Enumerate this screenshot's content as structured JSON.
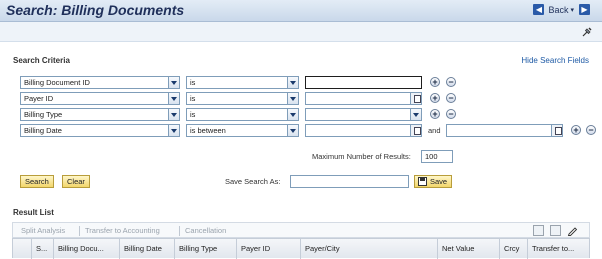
{
  "header": {
    "title": "Search: Billing Documents",
    "back_label": "Back"
  },
  "search_criteria": {
    "heading": "Search Criteria",
    "hide_link": "Hide Search Fields",
    "rows": [
      {
        "field": "Billing Document ID",
        "operator": "is",
        "value": ""
      },
      {
        "field": "Payer ID",
        "operator": "is",
        "value": ""
      },
      {
        "field": "Billing Type",
        "operator": "is",
        "value": ""
      },
      {
        "field": "Billing Date",
        "operator": "is between",
        "value": "",
        "and_label": "and",
        "value2": ""
      }
    ],
    "max_results_label": "Maximum Number of Results:",
    "max_results_value": "100",
    "search_button": "Search",
    "clear_button": "Clear",
    "save_search_label": "Save Search As:",
    "save_search_value": "",
    "save_button": "Save"
  },
  "result_list": {
    "heading": "Result List",
    "toolbar": [
      "Split Analysis",
      "Transfer to Accounting",
      "Cancellation"
    ],
    "columns": [
      "S...",
      "Billing Docu...",
      "Billing Date",
      "Billing Type",
      "Payer ID",
      "Payer/City",
      "Net Value",
      "Crcy",
      "Transfer to..."
    ]
  },
  "icons": {
    "back": "back-arrow-icon",
    "forward": "forward-arrow-icon",
    "pin": "pin-icon",
    "export": "spreadsheet-export-icon",
    "print": "print-icon",
    "edit": "pencil-icon"
  },
  "colors": {
    "title": "#1f2f5a",
    "link": "#1e5aa5",
    "button_yellow": "#f2d66b"
  }
}
